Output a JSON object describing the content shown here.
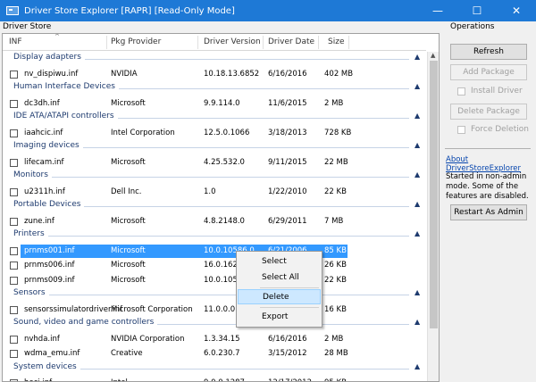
{
  "window": {
    "title": "Driver Store Explorer [RAPR] [Read-Only Mode]",
    "minimize_glyph": "—",
    "maximize_glyph": "☐",
    "close_glyph": "✕"
  },
  "left_pane": {
    "label": "Driver Store",
    "columns": [
      "INF",
      "Pkg Provider",
      "Driver Version",
      "Driver Date",
      "Size"
    ],
    "sort_glyph": "^",
    "chevron": "▲",
    "groups": [
      {
        "name": "Display adapters",
        "rows": [
          {
            "inf": "nv_dispiwu.inf",
            "provider": "NVIDIA",
            "version": "10.18.13.6852",
            "date": "6/16/2016",
            "size": "402 MB"
          }
        ]
      },
      {
        "name": "Human Interface Devices",
        "rows": [
          {
            "inf": "dc3dh.inf",
            "provider": "Microsoft",
            "version": "9.9.114.0",
            "date": "11/6/2015",
            "size": "2 MB"
          }
        ]
      },
      {
        "name": "IDE ATA/ATAPI controllers",
        "rows": [
          {
            "inf": "iaahcic.inf",
            "provider": "Intel Corporation",
            "version": "12.5.0.1066",
            "date": "3/18/2013",
            "size": "728 KB"
          }
        ]
      },
      {
        "name": "Imaging devices",
        "rows": [
          {
            "inf": "lifecam.inf",
            "provider": "Microsoft",
            "version": "4.25.532.0",
            "date": "9/11/2015",
            "size": "22 MB"
          }
        ]
      },
      {
        "name": "Monitors",
        "rows": [
          {
            "inf": "u2311h.inf",
            "provider": "Dell Inc.",
            "version": "1.0",
            "date": "1/22/2010",
            "size": "22 KB"
          }
        ]
      },
      {
        "name": "Portable Devices",
        "rows": [
          {
            "inf": "zune.inf",
            "provider": "Microsoft",
            "version": "4.8.2148.0",
            "date": "6/29/2011",
            "size": "7 MB"
          }
        ]
      },
      {
        "name": "Printers",
        "rows": [
          {
            "inf": "prnms001.inf",
            "provider": "Microsoft",
            "version": "10.0.10586.0",
            "date": "6/21/2006",
            "size": "85 KB",
            "selected": true
          },
          {
            "inf": "prnms006.inf",
            "provider": "Microsoft",
            "version": "16.0.1626",
            "date": "",
            "size": "26 KB"
          },
          {
            "inf": "prnms009.inf",
            "provider": "Microsoft",
            "version": "10.0.1058",
            "date": "",
            "size": "22 KB"
          }
        ]
      },
      {
        "name": "Sensors",
        "rows": [
          {
            "inf": "sensorssimulatordriver.inf",
            "provider": "Microsoft Corporation",
            "version": "11.0.0.0",
            "date": "",
            "size": "16 KB"
          }
        ]
      },
      {
        "name": "Sound, video and game controllers",
        "rows": [
          {
            "inf": "nvhda.inf",
            "provider": "NVIDIA Corporation",
            "version": "1.3.34.15",
            "date": "6/16/2016",
            "size": "2 MB"
          },
          {
            "inf": "wdma_emu.inf",
            "provider": "Creative",
            "version": "6.0.230.7",
            "date": "3/15/2012",
            "size": "28 MB"
          }
        ]
      },
      {
        "name": "System devices",
        "rows": [
          {
            "inf": "heci.inf",
            "provider": "Intel",
            "version": "9.0.0.1287",
            "date": "12/17/2012",
            "size": "95 KB"
          }
        ]
      }
    ]
  },
  "context_menu": {
    "items": [
      "Select",
      "Select All",
      "Delete",
      "Export"
    ],
    "highlighted": "Delete"
  },
  "right_pane": {
    "label": "Operations",
    "refresh_label": "Refresh",
    "add_package_label": "Add Package",
    "install_driver_label": "Install Driver",
    "delete_package_label": "Delete Package",
    "force_deletion_label": "Force Deletion",
    "about_link": "About DriverStoreExplorer",
    "info_text": "Started in non-admin mode. Some of the features are disabled.",
    "restart_label": "Restart As Admin"
  }
}
